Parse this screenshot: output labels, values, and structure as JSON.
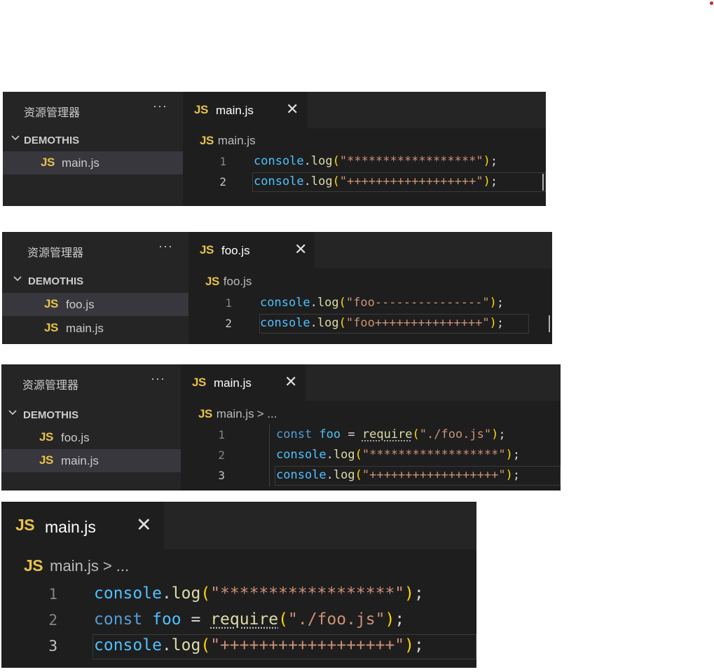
{
  "explorer_title": "资源管理器",
  "more_label": "···",
  "folder_name": "DEMOTHIS",
  "js_badge": "JS",
  "close_label": "✕",
  "panel1": {
    "files": [
      "main.js"
    ],
    "tab": "main.js",
    "breadcrumb": "main.js",
    "lines": [
      {
        "n": "1",
        "obj": "console",
        "dot": ".",
        "fn": "log",
        "open": "(",
        "str": "\"******************\"",
        "close": ")",
        "semi": ";"
      },
      {
        "n": "2",
        "obj": "console",
        "dot": ".",
        "fn": "log",
        "open": "(",
        "str": "\"++++++++++++++++++\"",
        "close": ")",
        "semi": ";"
      }
    ]
  },
  "panel2": {
    "files": [
      "foo.js",
      "main.js"
    ],
    "tab": "foo.js",
    "breadcrumb": "foo.js",
    "lines": [
      {
        "n": "1",
        "obj": "console",
        "dot": ".",
        "fn": "log",
        "open": "(",
        "str": "\"foo---------------\"",
        "close": ")",
        "semi": ";"
      },
      {
        "n": "2",
        "obj": "console",
        "dot": ".",
        "fn": "log",
        "open": "(",
        "str": "\"foo+++++++++++++++\"",
        "close": ")",
        "semi": ";"
      }
    ]
  },
  "panel3": {
    "files": [
      "foo.js",
      "main.js"
    ],
    "tab": "main.js",
    "breadcrumb": "main.js",
    "breadcrumb_more": "> ...",
    "req": {
      "n": "1",
      "kw": "const",
      "name": "foo",
      "eq": " = ",
      "fn": "require",
      "open": "(",
      "str": "\"./foo.js\"",
      "close": ")",
      "semi": ";"
    },
    "lines": [
      {
        "n": "2",
        "obj": "console",
        "dot": ".",
        "fn": "log",
        "open": "(",
        "str": "\"******************\"",
        "close": ")",
        "semi": ";"
      },
      {
        "n": "3",
        "obj": "console",
        "dot": ".",
        "fn": "log",
        "open": "(",
        "str": "\"++++++++++++++++++\"",
        "close": ")",
        "semi": ";"
      }
    ]
  },
  "panel4": {
    "tab": "main.js",
    "breadcrumb": "main.js",
    "breadcrumb_more": "> ...",
    "line1": {
      "n": "1",
      "obj": "console",
      "dot": ".",
      "fn": "log",
      "open": "(",
      "str": "\"******************\"",
      "close": ")",
      "semi": ";"
    },
    "req": {
      "n": "2",
      "kw": "const",
      "name": "foo",
      "eq": " = ",
      "fn": "require",
      "open": "(",
      "str": "\"./foo.js\"",
      "close": ")",
      "semi": ";"
    },
    "line3": {
      "n": "3",
      "obj": "console",
      "dot": ".",
      "fn": "log",
      "open": "(",
      "str": "\"++++++++++++++++++\"",
      "close": ")",
      "semi": ";"
    }
  }
}
